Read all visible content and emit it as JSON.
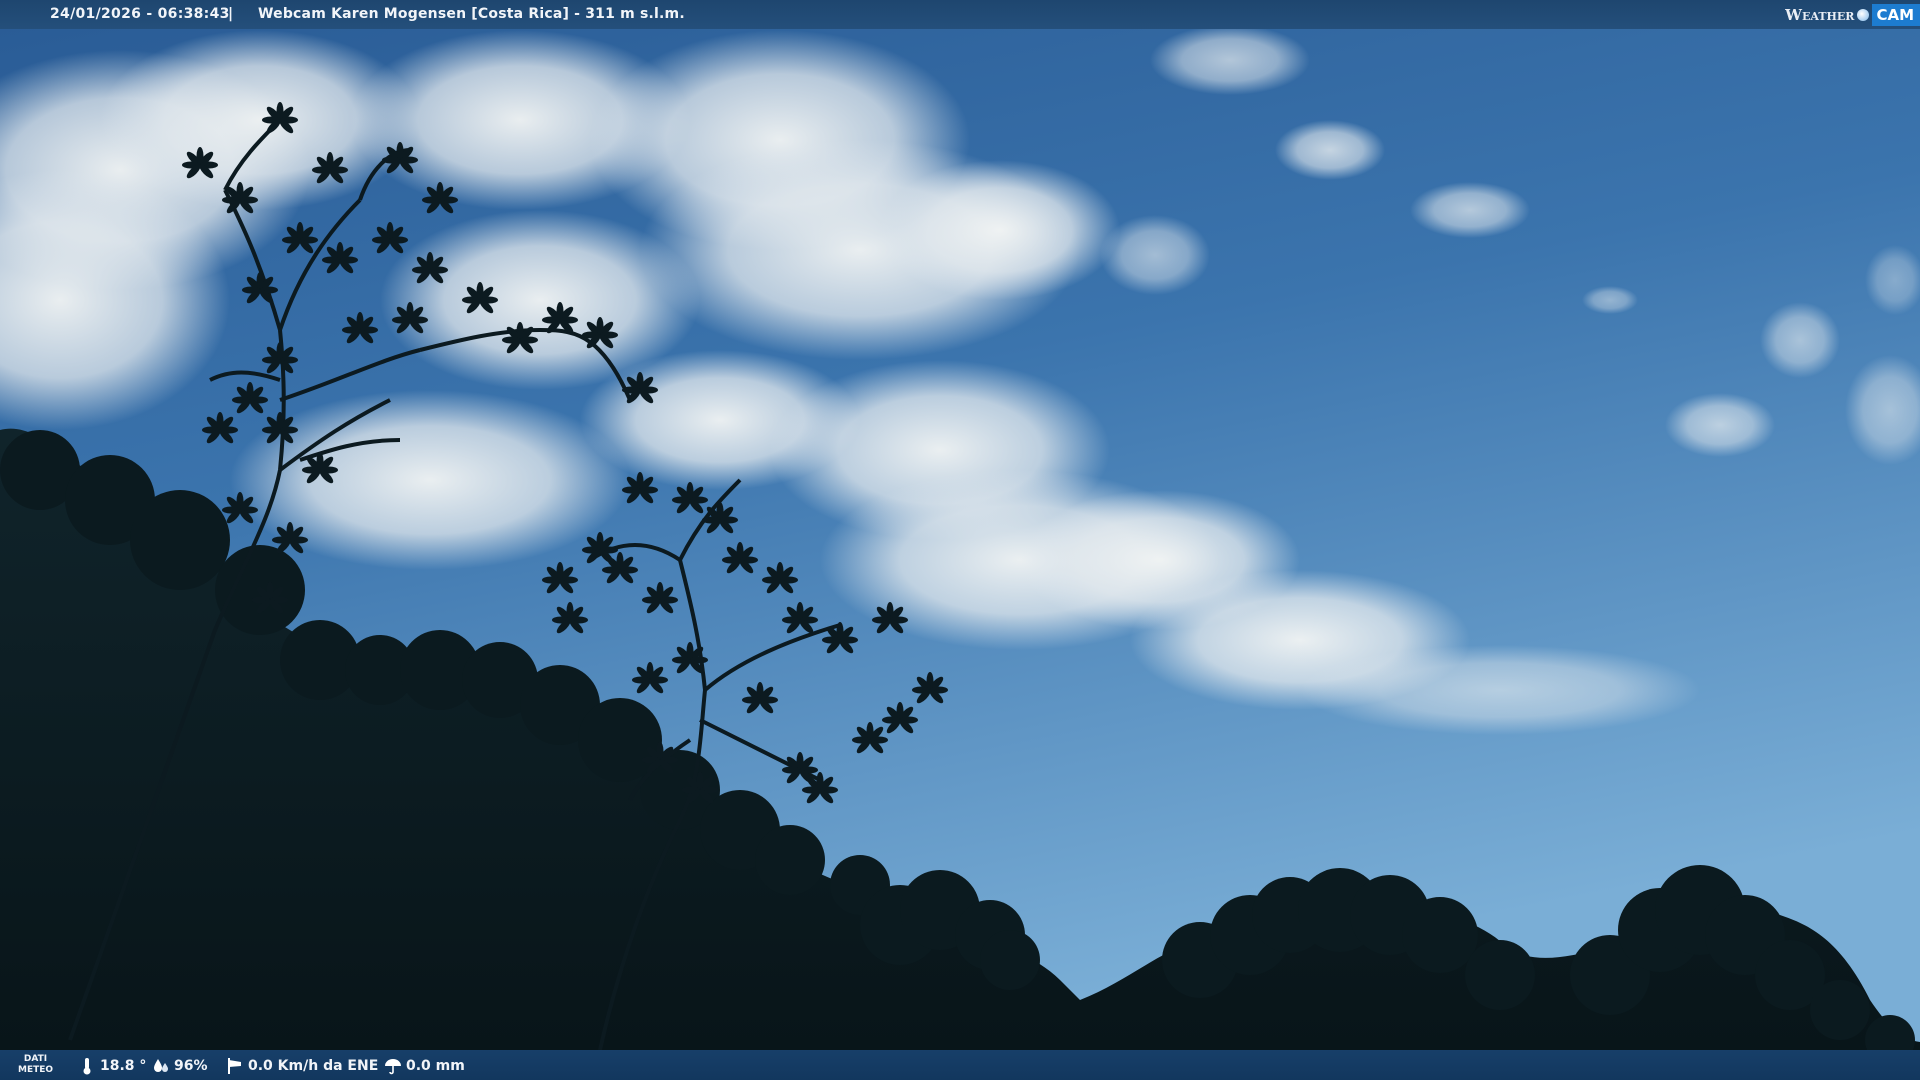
{
  "overlay_top": {
    "timestamp": "24/01/2026 - 06:38:43",
    "separator": "|",
    "title": "Webcam Karen Mogensen [Costa Rica]  - 311 m s.l.m."
  },
  "logo": {
    "word": "Weather",
    "cam": "CAM"
  },
  "overlay_bottom": {
    "label_line1": "DATI",
    "label_line2": "METEO",
    "temperature": "18.8 °",
    "humidity": "96%",
    "wind": "0.0 Km/h da ENE",
    "rain": "0.0 mm"
  },
  "icons": {
    "temperature": "thermometer-icon",
    "humidity": "humidity-drops-icon",
    "wind": "windsock-icon",
    "rain": "rain-umbrella-icon"
  },
  "colors": {
    "sky_top": "#2b5e98",
    "sky_bottom": "#6aa2cf",
    "cloud": "#e9eef1",
    "foliage": "#0b1a1f",
    "bar": "#1e466f",
    "logo_cam": "#1d7cd0"
  }
}
